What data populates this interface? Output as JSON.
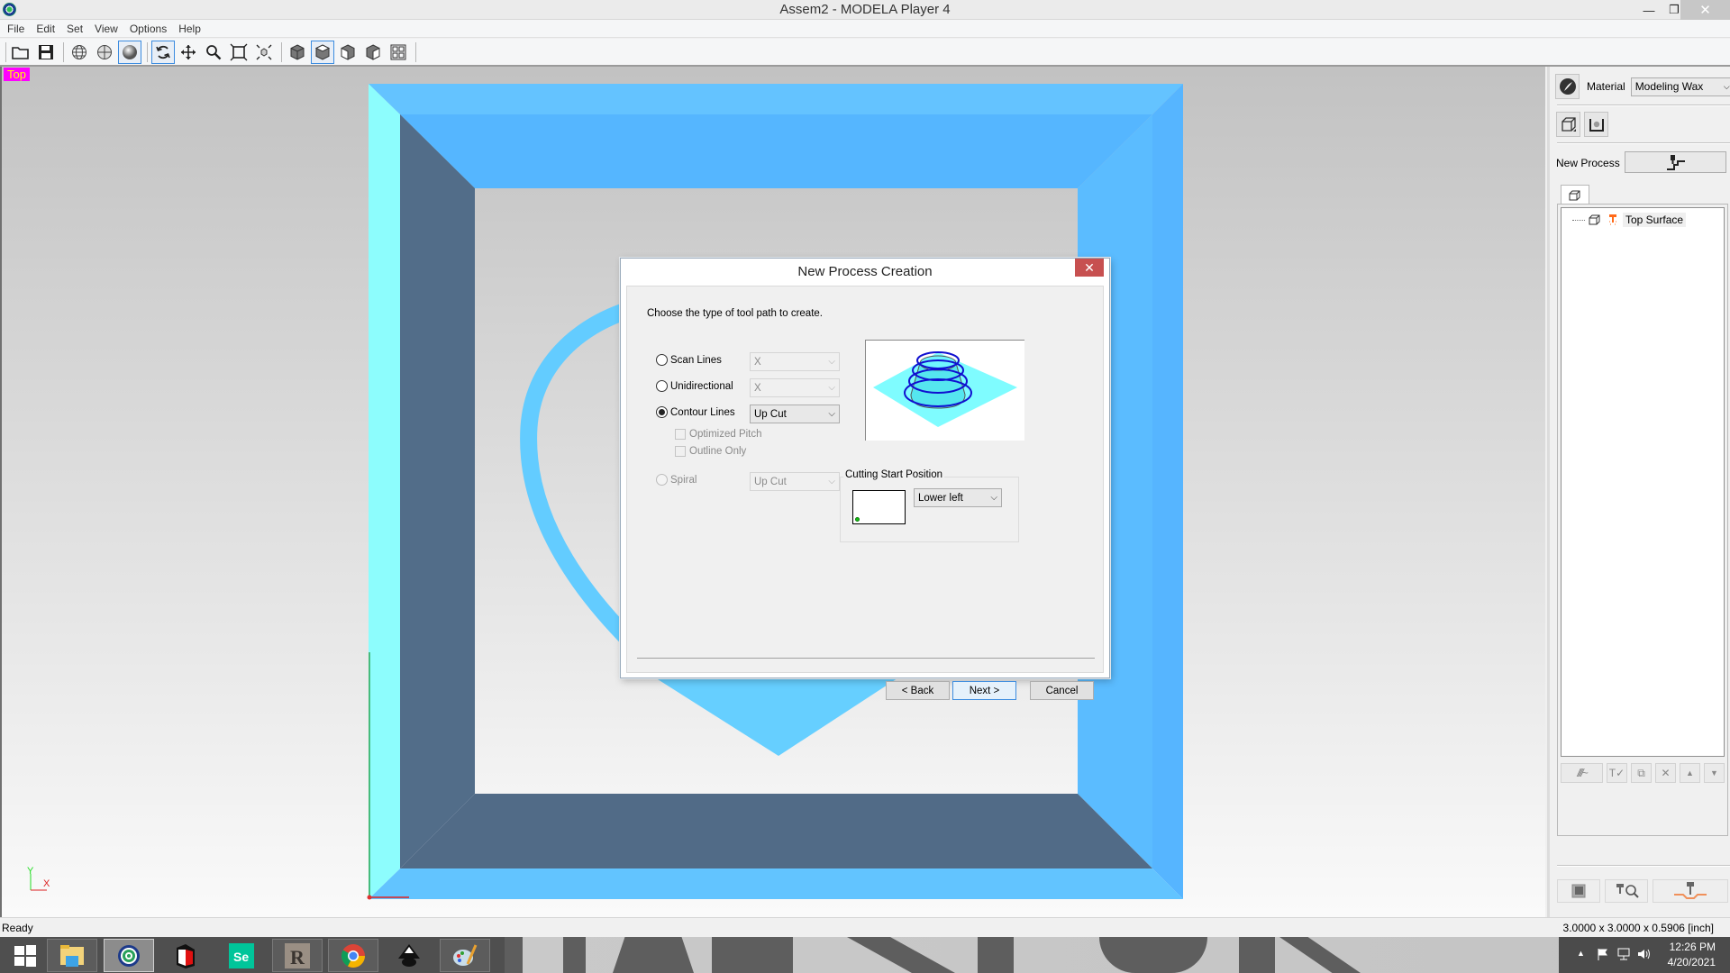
{
  "window": {
    "title": "Assem2 - MODELA Player 4",
    "controls": {
      "minimize": "—",
      "maximize": "❐",
      "close": "✕"
    }
  },
  "menu": [
    "File",
    "Edit",
    "Set",
    "View",
    "Options",
    "Help"
  ],
  "toolbar": {
    "buttons": [
      {
        "icon": "open-folder-icon"
      },
      {
        "icon": "save-icon"
      },
      {
        "icon": "wireframe-globe-icon"
      },
      {
        "icon": "hidden-line-globe-icon"
      },
      {
        "icon": "shaded-sphere-icon",
        "active": true
      },
      {
        "icon": "rotate-icon",
        "active": true
      },
      {
        "icon": "pan-icon"
      },
      {
        "icon": "zoom-icon"
      },
      {
        "icon": "fit-window-icon"
      },
      {
        "icon": "fit-model-icon"
      },
      {
        "icon": "view-iso-icon"
      },
      {
        "icon": "view-top-icon",
        "active": true
      },
      {
        "icon": "view-front-icon"
      },
      {
        "icon": "view-right-icon"
      },
      {
        "icon": "multi-view-icon"
      }
    ]
  },
  "viewport": {
    "view_label": "Top",
    "axis": {
      "y": "Y",
      "x": "X"
    },
    "colors": {
      "outer_frame": "#5fc4ff",
      "left_face": "#8cfdfd",
      "inner_wall": "#516b87",
      "heart": "#66ceff",
      "label_bg": "#ff00ff",
      "label_fg": "#ffff00"
    }
  },
  "right_panel": {
    "material_label": "Material",
    "material_value": "Modeling Wax",
    "new_process_label": "New Process",
    "tree": {
      "items": [
        {
          "label": "Top Surface"
        }
      ]
    }
  },
  "dialog": {
    "title": "New Process Creation",
    "close": "✕",
    "instruction": "Choose the type of tool path to create.",
    "options": [
      {
        "label": "Scan Lines",
        "checked": false,
        "enabled": false,
        "combo": "X",
        "combo_enabled": false
      },
      {
        "label": "Unidirectional",
        "checked": false,
        "enabled": true,
        "combo": "X",
        "combo_enabled": false
      },
      {
        "label": "Contour Lines",
        "checked": true,
        "enabled": true,
        "combo": "Up Cut",
        "combo_enabled": true
      },
      {
        "label": "Spiral",
        "checked": false,
        "enabled": false,
        "combo": "Up Cut",
        "combo_enabled": false
      }
    ],
    "checkboxes": [
      {
        "label": "Optimized Pitch",
        "checked": false,
        "enabled": false
      },
      {
        "label": "Outline Only",
        "checked": false,
        "enabled": false
      }
    ],
    "cutting_start": {
      "group_label": "Cutting Start Position",
      "value": "Lower left"
    },
    "buttons": {
      "back": "< Back",
      "next": "Next >",
      "cancel": "Cancel"
    }
  },
  "statusbar": {
    "status": "Ready",
    "dimensions": "3.0000 x 3.0000 x 0.5906 [inch]"
  },
  "taskbar": {
    "apps": [
      {
        "name": "start"
      },
      {
        "name": "file-explorer"
      },
      {
        "name": "modela-player",
        "active": true
      },
      {
        "name": "roland-app"
      },
      {
        "name": "selenium-ide"
      },
      {
        "name": "r-app"
      },
      {
        "name": "chrome"
      },
      {
        "name": "inkscape"
      },
      {
        "name": "paint"
      }
    ],
    "time": "12:26 PM",
    "date": "4/20/2021"
  }
}
